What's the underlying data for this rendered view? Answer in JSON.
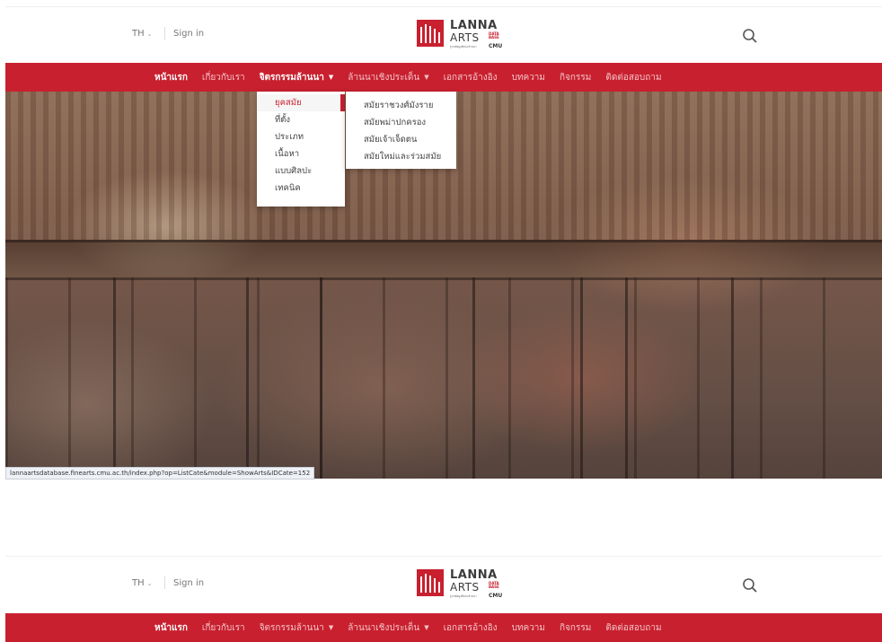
{
  "header": {
    "lang": "TH",
    "signin": "Sign in",
    "logo": {
      "line1": "LANNA",
      "line2": "ARTS",
      "db": [
        "DATA",
        "BASE"
      ],
      "cmu": "CMU",
      "tagline": "ฐานข้อมูลศิลปะล้านนา"
    }
  },
  "nav": [
    {
      "label": "หน้าแรก",
      "state": "active"
    },
    {
      "label": "เกี่ยวกับเรา",
      "state": ""
    },
    {
      "label": "จิตรกรรมล้านนา",
      "state": "open",
      "dropdown": true
    },
    {
      "label": "ล้านนาเชิงประเด็น",
      "state": "",
      "dropdown": true
    },
    {
      "label": "เอกสารอ้างอิง",
      "state": ""
    },
    {
      "label": "บทความ",
      "state": ""
    },
    {
      "label": "กิจกรรม",
      "state": ""
    },
    {
      "label": "ติดต่อสอบถาม",
      "state": ""
    }
  ],
  "nav_second": [
    {
      "label": "หน้าแรก",
      "state": "active"
    },
    {
      "label": "เกี่ยวกับเรา",
      "state": ""
    },
    {
      "label": "จิตรกรรมล้านนา",
      "state": "",
      "dropdown": true
    },
    {
      "label": "ล้านนาเชิงประเด็น",
      "state": "",
      "dropdown": true
    },
    {
      "label": "เอกสารอ้างอิง",
      "state": ""
    },
    {
      "label": "บทความ",
      "state": ""
    },
    {
      "label": "กิจกรรม",
      "state": ""
    },
    {
      "label": "ติดต่อสอบถาม",
      "state": ""
    }
  ],
  "submenu1": [
    "ยุคสมัย",
    "ที่ตั้ง",
    "ประเภท",
    "เนื้อหา",
    "แบบศิลปะ",
    "เทคนิค"
  ],
  "submenu2": [
    "สมัยราชวงศ์มังราย",
    "สมัยพม่าปกครอง",
    "สมัยเจ้าเจ็ดตน",
    "สมัยใหม่และร่วมสมัย"
  ],
  "status_url": "lannaartsdatabase.finearts.cmu.ac.th/index.php?op=ListCate&module=ShowArts&IDCate=152",
  "colors": {
    "brand": "#c8202f",
    "nav_text": "#f3c2c6"
  },
  "icons": {
    "search": "search-icon",
    "lang_caret": "chevron-down-icon"
  }
}
